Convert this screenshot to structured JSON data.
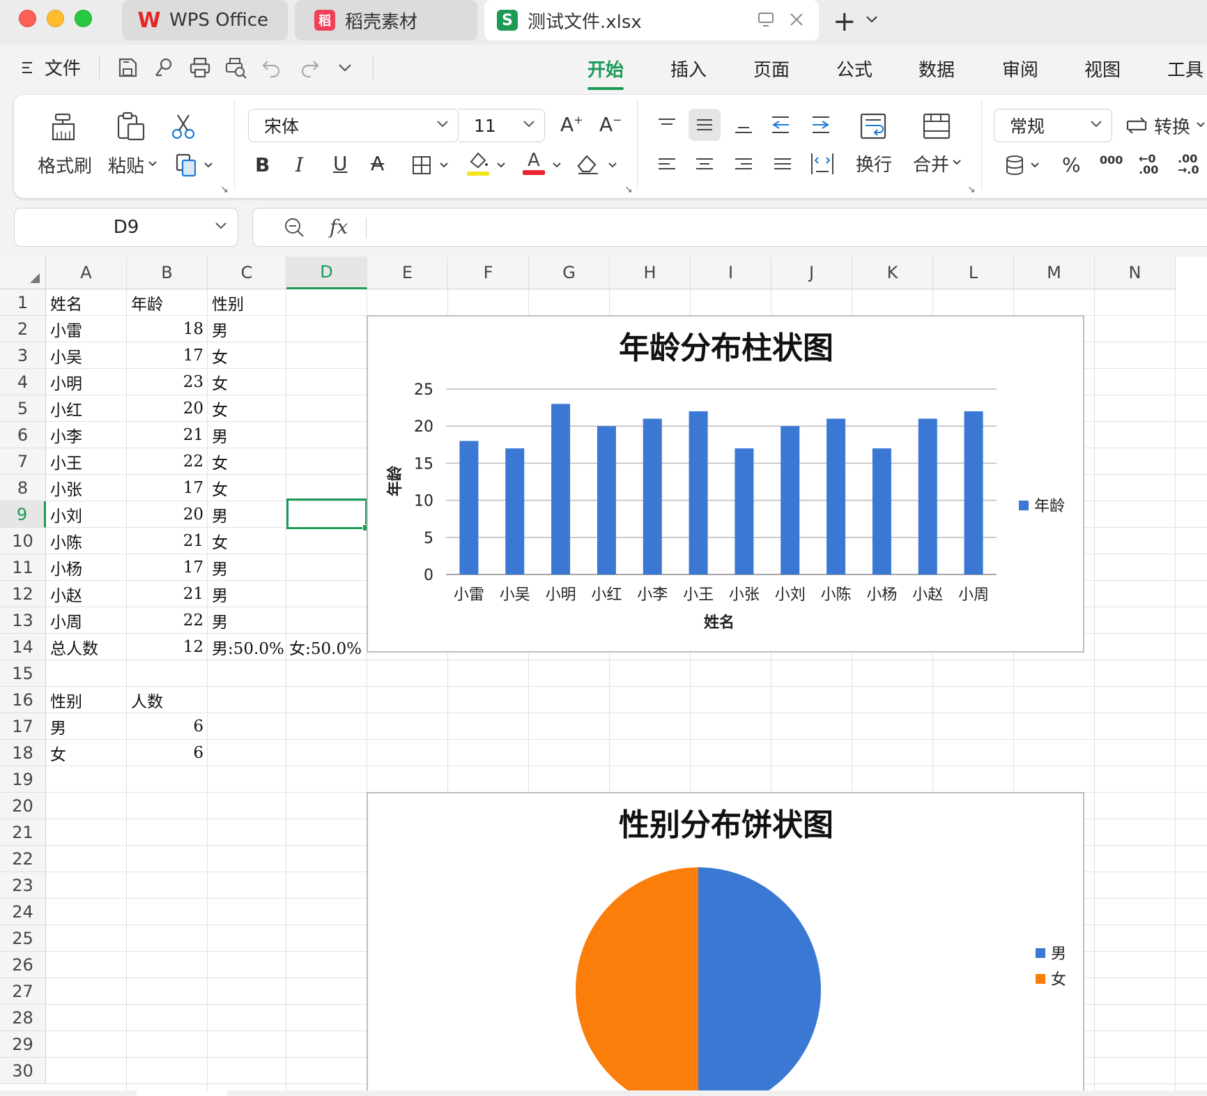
{
  "window": {
    "tabs": [
      {
        "label": "WPS Office",
        "logo": "W"
      },
      {
        "label": "稻壳素材",
        "logo": "稻"
      },
      {
        "label": "测试文件.xlsx",
        "logo": "S"
      }
    ],
    "new_tab": "+"
  },
  "menu": {
    "file_label": "文件",
    "tabs": [
      "开始",
      "插入",
      "页面",
      "公式",
      "数据",
      "审阅",
      "视图",
      "工具"
    ],
    "active_tab": "开始"
  },
  "ribbon": {
    "format_painter": "格式刷",
    "paste": "粘贴",
    "font_name": "宋体",
    "font_size": "11",
    "bold": "B",
    "italic": "I",
    "underline": "U",
    "strike": "A",
    "wrap": "换行",
    "merge": "合并",
    "number_format": "常规",
    "convert": "转换",
    "percent": "%",
    "thousands": "000",
    "dec_inc": "←0 .00",
    "dec_dec": ".00 →.0",
    "accent_color": "#1a9a55"
  },
  "formula_bar": {
    "cell_ref": "D9",
    "fx": "fx",
    "formula": ""
  },
  "sheet": {
    "columns": [
      "A",
      "B",
      "C",
      "D",
      "E",
      "F",
      "G",
      "H",
      "I",
      "J",
      "K",
      "L",
      "M",
      "N"
    ],
    "selected_column": "D",
    "selected_row": "9",
    "rows": [
      "1",
      "2",
      "3",
      "4",
      "5",
      "6",
      "7",
      "8",
      "9",
      "10",
      "11",
      "12",
      "13",
      "14",
      "15",
      "16",
      "17",
      "18",
      "19",
      "20",
      "21",
      "22",
      "23",
      "24",
      "25",
      "26",
      "27",
      "28",
      "29",
      "30"
    ],
    "table_header": [
      "姓名",
      "年龄",
      "性别"
    ],
    "people": [
      {
        "name": "小雷",
        "age": "18",
        "gender": "男"
      },
      {
        "name": "小吴",
        "age": "17",
        "gender": "女"
      },
      {
        "name": "小明",
        "age": "23",
        "gender": "女"
      },
      {
        "name": "小红",
        "age": "20",
        "gender": "女"
      },
      {
        "name": "小李",
        "age": "21",
        "gender": "男"
      },
      {
        "name": "小王",
        "age": "22",
        "gender": "女"
      },
      {
        "name": "小张",
        "age": "17",
        "gender": "女"
      },
      {
        "name": "小刘",
        "age": "20",
        "gender": "男"
      },
      {
        "name": "小陈",
        "age": "21",
        "gender": "女"
      },
      {
        "name": "小杨",
        "age": "17",
        "gender": "男"
      },
      {
        "name": "小赵",
        "age": "21",
        "gender": "男"
      },
      {
        "name": "小周",
        "age": "22",
        "gender": "男"
      }
    ],
    "total": {
      "label": "总人数",
      "count": "12",
      "ratio": "男:50.0%  女:50.0%"
    },
    "summary_header": [
      "性别",
      "人数"
    ],
    "summary": [
      {
        "gender": "男",
        "count": "6"
      },
      {
        "gender": "女",
        "count": "6"
      }
    ]
  },
  "chart_data": [
    {
      "type": "bar",
      "title": "年龄分布柱状图",
      "xlabel": "姓名",
      "ylabel": "年龄",
      "categories": [
        "小雷",
        "小吴",
        "小明",
        "小红",
        "小李",
        "小王",
        "小张",
        "小刘",
        "小陈",
        "小杨",
        "小赵",
        "小周"
      ],
      "series": [
        {
          "name": "年龄",
          "values": [
            18,
            17,
            23,
            20,
            21,
            22,
            17,
            20,
            21,
            17,
            21,
            22
          ],
          "color": "#3a78d4"
        }
      ],
      "yticks": [
        "0",
        "5",
        "10",
        "15",
        "20",
        "25"
      ],
      "ylim": [
        0,
        25
      ],
      "grid": true,
      "legend": "right"
    },
    {
      "type": "pie",
      "title": "性别分布饼状图",
      "categories": [
        "男",
        "女"
      ],
      "values": [
        6,
        6
      ],
      "colors": [
        "#3a78d4",
        "#fb7d0a"
      ],
      "legend": "right"
    }
  ]
}
